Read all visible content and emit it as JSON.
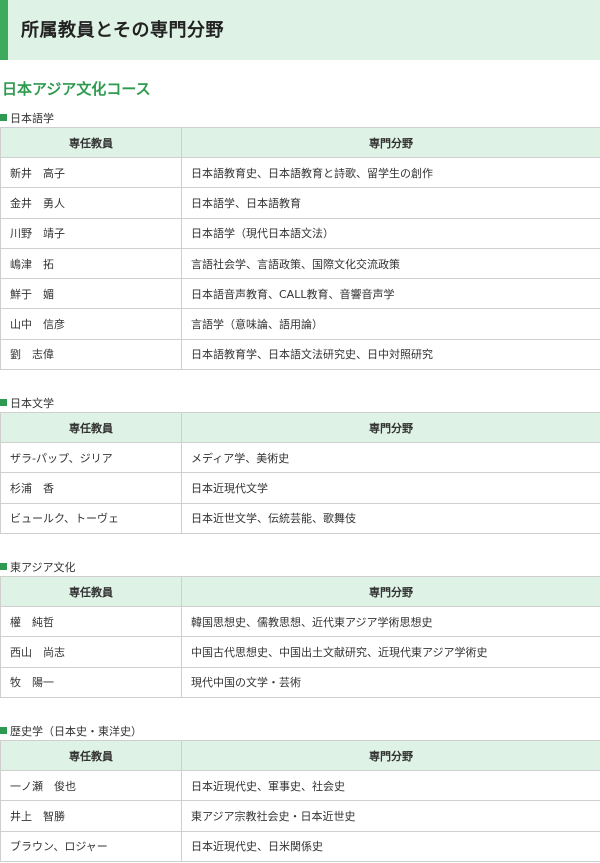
{
  "page_title": "所属教員とその専門分野",
  "course_title": "日本アジア文化コース",
  "table_headers": {
    "teacher": "専任教員",
    "field": "専門分野"
  },
  "colors": {
    "accent": "#2e9a4f",
    "header_bg": "#dff2e6",
    "border": "#cfcfcf"
  },
  "sections": [
    {
      "label": "日本語学",
      "rows": [
        {
          "teacher": "新井　高子",
          "field": "日本語教育史、日本語教育と詩歌、留学生の創作"
        },
        {
          "teacher": "金井　勇人",
          "field": "日本語学、日本語教育"
        },
        {
          "teacher": "川野　靖子",
          "field": "日本語学（現代日本語文法）"
        },
        {
          "teacher": "嶋津　拓",
          "field": "言語社会学、言語政策、国際文化交流政策"
        },
        {
          "teacher": "鮮于　媚",
          "field": "日本語音声教育、CALL教育、音響音声学"
        },
        {
          "teacher": "山中　信彦",
          "field": "言語学（意味論、語用論）"
        },
        {
          "teacher": "劉　志偉",
          "field": "日本語教育学、日本語文法研究史、日中対照研究"
        }
      ]
    },
    {
      "label": "日本文学",
      "rows": [
        {
          "teacher": "ザラ-パップ、ジリア",
          "field": "メディア学、美術史"
        },
        {
          "teacher": "杉浦　香",
          "field": "日本近現代文学"
        },
        {
          "teacher": "ビュールク、トーヴェ",
          "field": "日本近世文学、伝統芸能、歌舞伎"
        }
      ]
    },
    {
      "label": "東アジア文化",
      "rows": [
        {
          "teacher": "權　純哲",
          "field": "韓国思想史、儒教思想、近代東アジア学術思想史"
        },
        {
          "teacher": "西山　尚志",
          "field": "中国古代思想史、中国出土文献研究、近現代東アジア学術史"
        },
        {
          "teacher": "牧　陽一",
          "field": "現代中国の文学・芸術"
        }
      ]
    },
    {
      "label": "歴史学（日本史・東洋史）",
      "rows": [
        {
          "teacher": "一ノ瀬　俊也",
          "field": "日本近現代史、軍事史、社会史"
        },
        {
          "teacher": "井上　智勝",
          "field": "東アジア宗教社会史・日本近世史"
        },
        {
          "teacher": "ブラウン、ロジャー",
          "field": "日本近現代史、日米関係史"
        }
      ]
    }
  ]
}
